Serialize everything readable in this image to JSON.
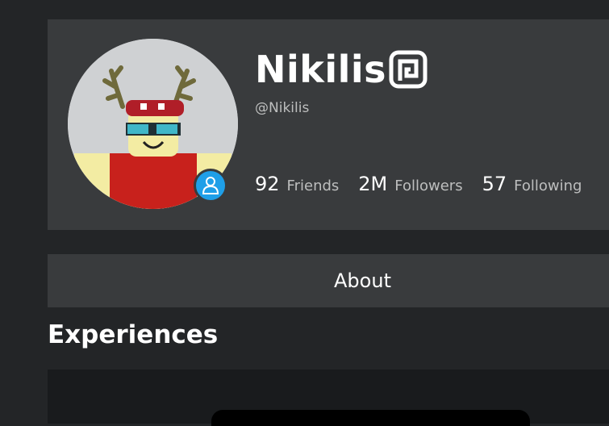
{
  "profile": {
    "display_name": "Nikilis",
    "username": "@Nikilis",
    "avatar_icon": "avatar-headshot",
    "badge_icon": "premium-icon",
    "presence_icon": "user-presence-icon",
    "presence_color": "#1f9fe8"
  },
  "stats": [
    {
      "value": "92",
      "label": "Friends"
    },
    {
      "value": "2M",
      "label": "Followers"
    },
    {
      "value": "57",
      "label": "Following"
    }
  ],
  "tabs": {
    "about_label": "About"
  },
  "sections": {
    "experiences_title": "Experiences"
  },
  "colors": {
    "page_background": "#232527",
    "card_background": "#393b3d",
    "secondary_text": "#bdbebe"
  }
}
